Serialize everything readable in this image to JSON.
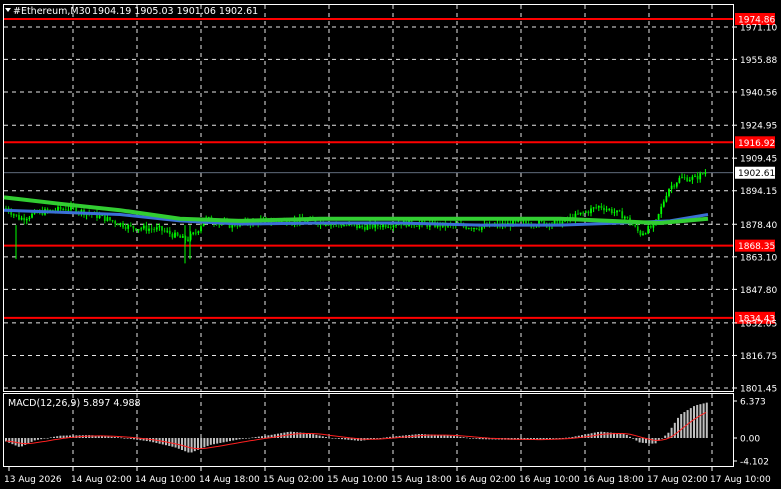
{
  "header": {
    "symbol": "#Ethereum,M30",
    "ohlc": "1904.19 1905.03 1901.06 1902.61"
  },
  "price_axis": {
    "ticks": [
      "1971.10",
      "1955.88",
      "1940.56",
      "1924.95",
      "1909.45",
      "1894.15",
      "1878.40",
      "1863.10",
      "1847.80",
      "1832.05",
      "1816.75",
      "1801.45"
    ],
    "tick_values": [
      1971.1,
      1955.88,
      1940.56,
      1924.95,
      1909.45,
      1894.15,
      1878.4,
      1863.1,
      1847.8,
      1832.05,
      1816.75,
      1801.45
    ],
    "current_price": "1902.61",
    "current_price_value": 1902.61
  },
  "levels": [
    {
      "label": "1974.86",
      "value": 1974.86
    },
    {
      "label": "1916.92",
      "value": 1916.92
    },
    {
      "label": "1868.35",
      "value": 1868.35
    },
    {
      "label": "1834.43",
      "value": 1834.43
    }
  ],
  "time_axis": {
    "labels": [
      "13 Aug 2026",
      "14 Aug 02:00",
      "14 Aug 10:00",
      "14 Aug 18:00",
      "15 Aug 02:00",
      "15 Aug 10:00",
      "15 Aug 18:00",
      "16 Aug 02:00",
      "16 Aug 10:00",
      "16 Aug 18:00",
      "17 Aug 02:00",
      "17 Aug 10:00"
    ]
  },
  "macd": {
    "title": "MACD(12,26,9) 5.897 4.988",
    "ticks": [
      "6.373",
      "0.00",
      "-4.102"
    ],
    "tick_values": [
      6.373,
      0.0,
      -4.102
    ]
  },
  "colors": {
    "background": "#000000",
    "grid": "#ffffff",
    "bull_candle": "#00ff00",
    "bear_candle": "#00c800",
    "level_line": "#ff0000",
    "ma_fast": "#32cd32",
    "ma_slow": "#3b6fd6",
    "macd_hist": "#c0c0c0",
    "macd_signal": "#ff2020"
  }
}
